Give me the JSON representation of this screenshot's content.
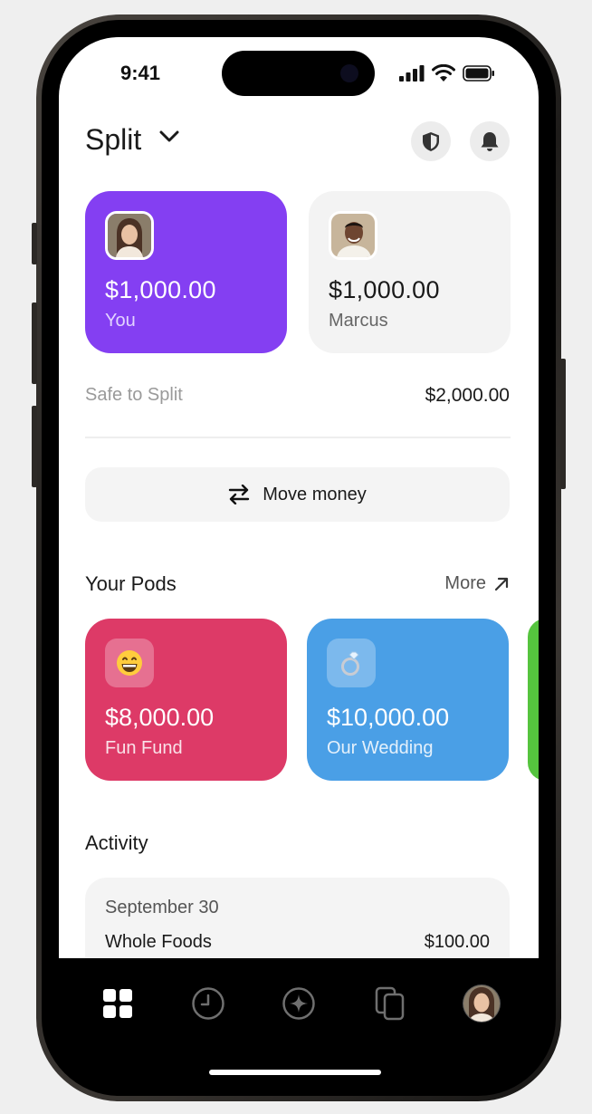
{
  "status_bar": {
    "time": "9:41"
  },
  "header": {
    "title": "Split"
  },
  "accounts": [
    {
      "amount": "$1,000.00",
      "name": "You"
    },
    {
      "amount": "$1,000.00",
      "name": "Marcus"
    }
  ],
  "safe_to_split": {
    "label": "Safe to Split",
    "amount": "$2,000.00"
  },
  "move_money": {
    "label": "Move money"
  },
  "pods": {
    "title": "Your Pods",
    "more_label": "More",
    "items": [
      {
        "amount": "$8,000.00",
        "name": "Fun Fund",
        "emoji": "😁"
      },
      {
        "amount": "$10,000.00",
        "name": "Our Wedding",
        "emoji": "💍"
      }
    ]
  },
  "activity": {
    "title": "Activity",
    "date": "September 30",
    "merchant": "Whole Foods",
    "amount": "$100.00"
  },
  "colors": {
    "you_card": "#843ff2",
    "fun_fund": "#dd3a67",
    "wedding": "#4a9fe6",
    "partial_pod": "#55c43e"
  },
  "tab_icons": [
    "grid-icon",
    "clock-icon",
    "sparkle-icon",
    "cards-icon",
    "profile-avatar"
  ]
}
